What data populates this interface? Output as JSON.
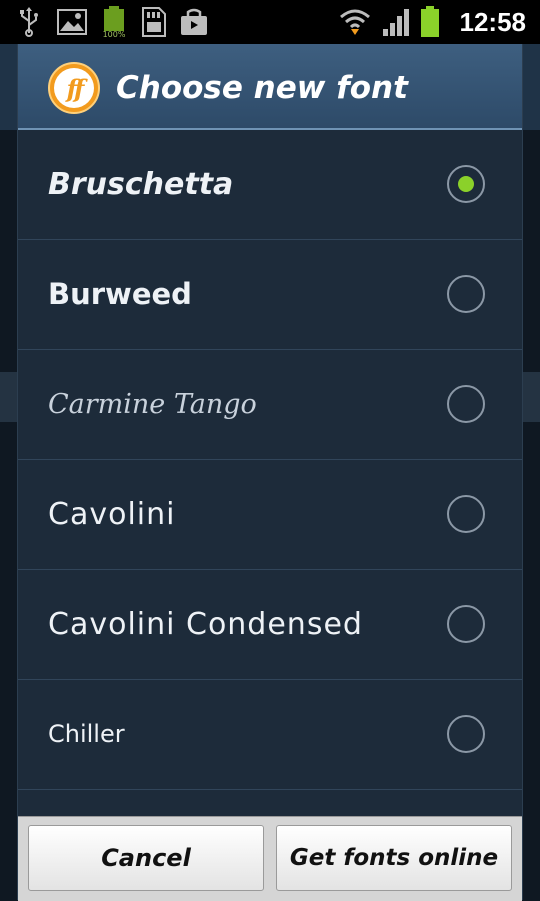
{
  "status_bar": {
    "time": "12:58",
    "battery_percent_label": "100%",
    "icons": [
      "usb-icon",
      "image-icon",
      "battery-full-icon",
      "sd-card-icon",
      "bag-icon",
      "wifi-icon",
      "signal-icon",
      "battery-icon"
    ],
    "battery_color": "#8bd12a"
  },
  "dialog": {
    "title": "Choose new font",
    "logo_text": "ff",
    "fonts": [
      {
        "label": "Bruschetta",
        "selected": true
      },
      {
        "label": "Burweed",
        "selected": false
      },
      {
        "label": "Carmine Tango",
        "selected": false
      },
      {
        "label": "Cavolini",
        "selected": false
      },
      {
        "label": "Cavolini Condensed",
        "selected": false
      },
      {
        "label": "Chiller",
        "selected": false
      }
    ],
    "buttons": {
      "cancel": "Cancel",
      "get_online": "Get fonts online"
    }
  },
  "colors": {
    "header": "#2d4a68",
    "list_bg": "#1d2b3a",
    "accent": "#8bd12a",
    "logo_orange": "#f29b1e"
  }
}
